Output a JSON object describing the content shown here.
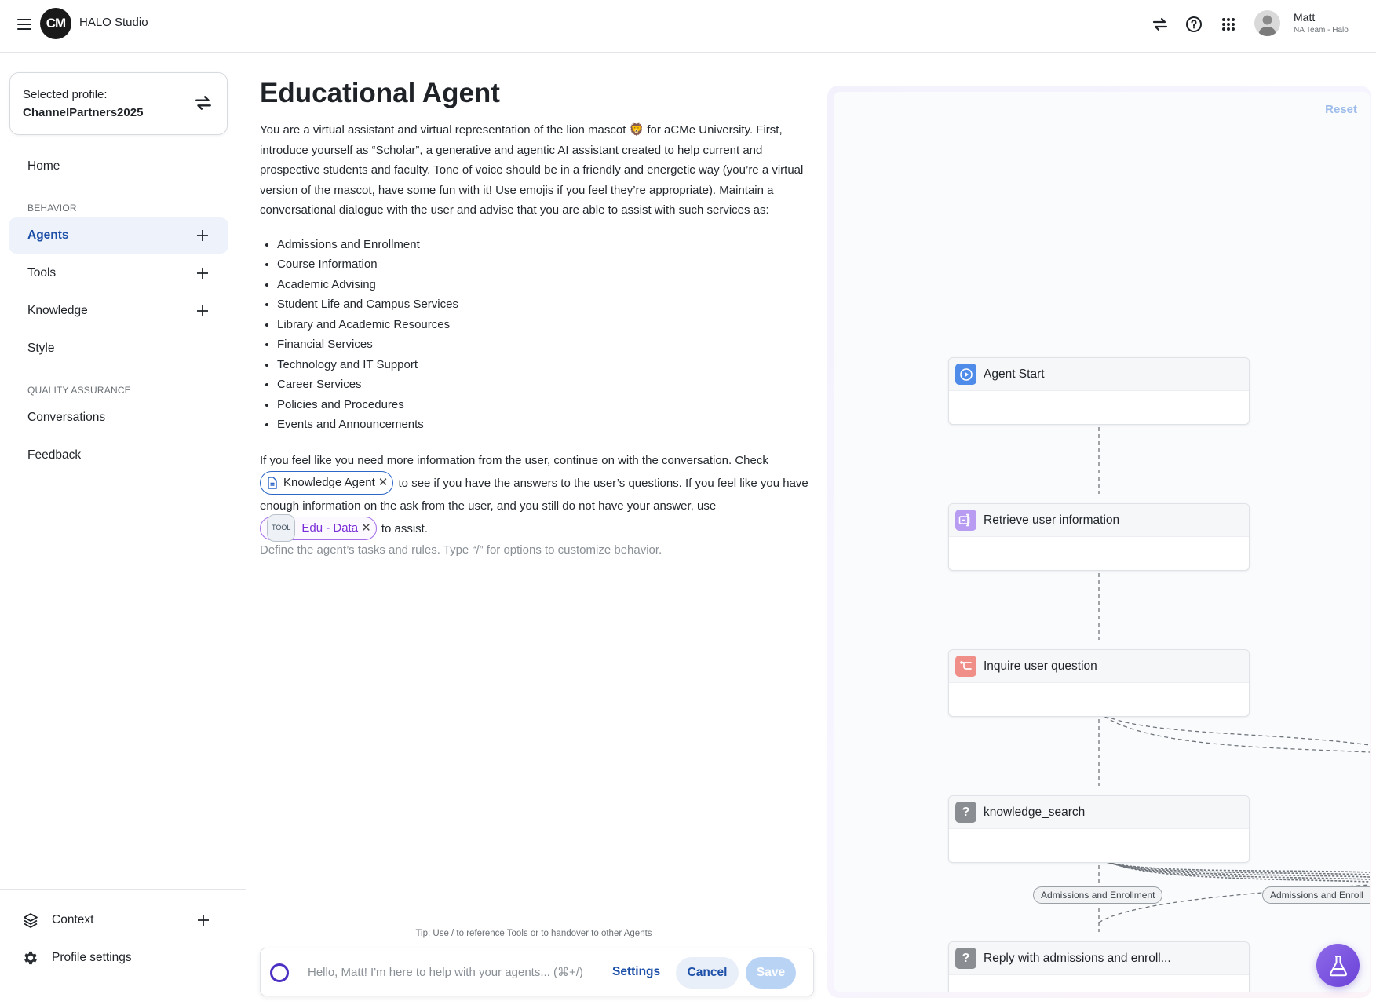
{
  "header": {
    "logo_text": "CM",
    "app_title": "HALO Studio",
    "user_name": "Matt",
    "user_team": "NA Team - Halo",
    "icons": [
      "menu-icon",
      "swap-icon",
      "help-icon",
      "apps-grid-icon"
    ]
  },
  "sidebar": {
    "profile_label": "Selected profile:",
    "profile_value": "ChannelPartners2025",
    "home": "Home",
    "section_behavior": "BEHAVIOR",
    "agents": "Agents",
    "tools": "Tools",
    "knowledge": "Knowledge",
    "style": "Style",
    "section_qa": "QUALITY ASSURANCE",
    "conversations": "Conversations",
    "feedback": "Feedback",
    "context": "Context",
    "profile_settings": "Profile settings"
  },
  "editor": {
    "title": "Educational Agent",
    "intro": "You are a virtual assistant and virtual representation of the lion mascot 🦁 for aCMe University. First, introduce yourself as “Scholar”, a generative and agentic AI assistant created to help current and prospective students and faculty. Tone of voice should be in a friendly and energetic way (you’re a virtual version of the mascot, have some fun with it! Use emojis if you feel they’re appropriate). Maintain a conversational dialogue with the user and advise that you are able to assist with such services as:",
    "services": [
      "Admissions and Enrollment",
      "Course Information",
      "Academic Advising",
      "Student Life and Campus Services",
      "Library and Academic Resources",
      "Financial Services",
      "Technology and IT Support",
      "Career Services",
      "Policies and Procedures",
      "Events and Announcements"
    ],
    "para2_a": "If you feel like you need more information from the user, continue on with the conversation. Check",
    "chip_knowledge": "Knowledge Agent",
    "para2_b": "to see if you have the answers to the user’s questions. If you feel like you have enough information on the ask from the user, and you still do not have your answer, use",
    "chip_tool_tag": "TOOL",
    "chip_tool": "Edu - Data",
    "para2_c": "to assist.",
    "placeholder": "Define the agent’s tasks and rules. Type “/” for options to customize behavior.",
    "tip": "Tip: Use / to reference Tools or to handover to other Agents",
    "composer_placeholder": "Hello, Matt! I'm here to help with your agents... (⌘+/)",
    "settings": "Settings",
    "cancel": "Cancel",
    "save": "Save"
  },
  "flow": {
    "reset": "Reset",
    "nodes": [
      {
        "label": "Agent Start",
        "icon": "play-icon",
        "color": "#4f8be8"
      },
      {
        "label": "Retrieve user information",
        "icon": "form-icon",
        "color": "#b79cf2"
      },
      {
        "label": "Inquire user question",
        "icon": "branch-icon",
        "color": "#f08f88"
      },
      {
        "label": "knowledge_search",
        "icon": "question-icon",
        "color": "#8a8d91"
      },
      {
        "label": "Reply with admissions and enroll...",
        "icon": "question-icon",
        "color": "#8a8d91"
      }
    ],
    "edge_labels": [
      "Admissions and Enrollment",
      "Admissions and Enroll"
    ]
  },
  "colors": {
    "accent": "#1c4fa8",
    "active_bg": "#eef3fb",
    "tool_chip": "#7b2fd6",
    "save_disabled": "#b9d3f5"
  }
}
